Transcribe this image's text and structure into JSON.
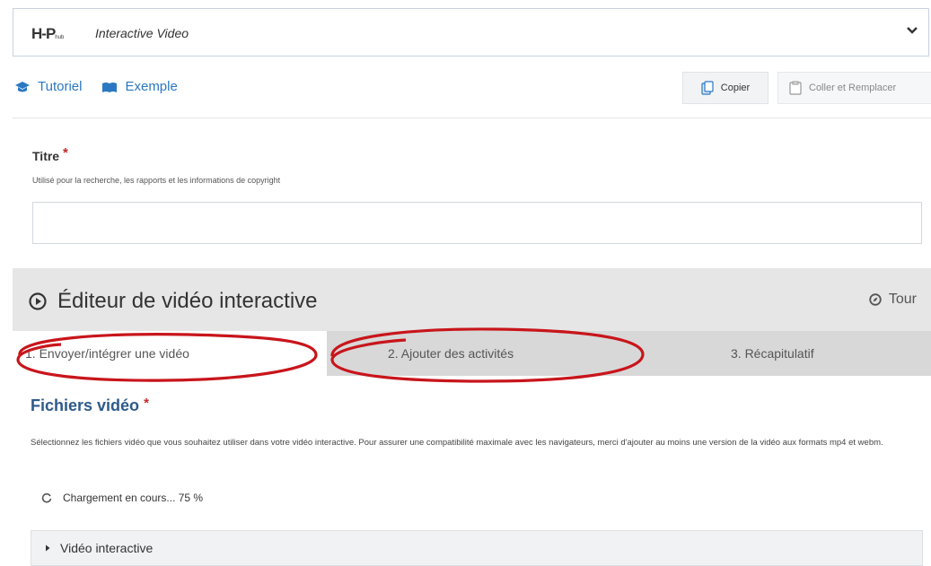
{
  "library_selector": {
    "logo": "H-P",
    "logo_sub": "hub",
    "name": "Interactive Video"
  },
  "help_links": {
    "tutorial": "Tutoriel",
    "example": "Exemple"
  },
  "clipboard": {
    "copy": "Copier",
    "paste_replace": "Coller et Remplacer"
  },
  "title_field": {
    "label": "Titre",
    "required_mark": "*",
    "description": "Utilisé pour la recherche, les rapports et les informations de copyright",
    "value": ""
  },
  "editor": {
    "title": "Éditeur de vidéo interactive",
    "tour": "Tour",
    "tabs": [
      {
        "label": "1. Envoyer/intégrer une vidéo",
        "active": true,
        "circled": true
      },
      {
        "label": "2. Ajouter des activités",
        "active": false,
        "circled": true
      },
      {
        "label": "3. Récapitulatif",
        "active": false,
        "circled": false
      }
    ]
  },
  "video_files": {
    "heading": "Fichiers vidéo",
    "required_mark": "*",
    "description": "Sélectionnez les fichiers vidéo que vous souhaitez utiliser dans votre vidéo interactive. Pour assurer une compatibilité maximale avec les navigateurs, merci d'ajouter au moins une version de la vidéo aux formats mp4 et webm.",
    "loading_text": "Chargement en cours... 75 %",
    "loading_progress": 0.75
  },
  "collapsible": {
    "label": "Vidéo interactive"
  },
  "colors": {
    "link": "#2a78c3",
    "heading": "#2d5a8a",
    "required": "#c62828",
    "annotation": "#c8151b"
  },
  "icons": {
    "tutorial": "graduation-cap-icon",
    "example": "open-book-icon",
    "copy": "copy-icon",
    "paste": "paste-icon",
    "editor": "play-circle-icon",
    "tour": "compass-icon",
    "loading": "spinner-icon",
    "expand": "caret-right-icon",
    "dropdown": "chevron-down-icon"
  }
}
